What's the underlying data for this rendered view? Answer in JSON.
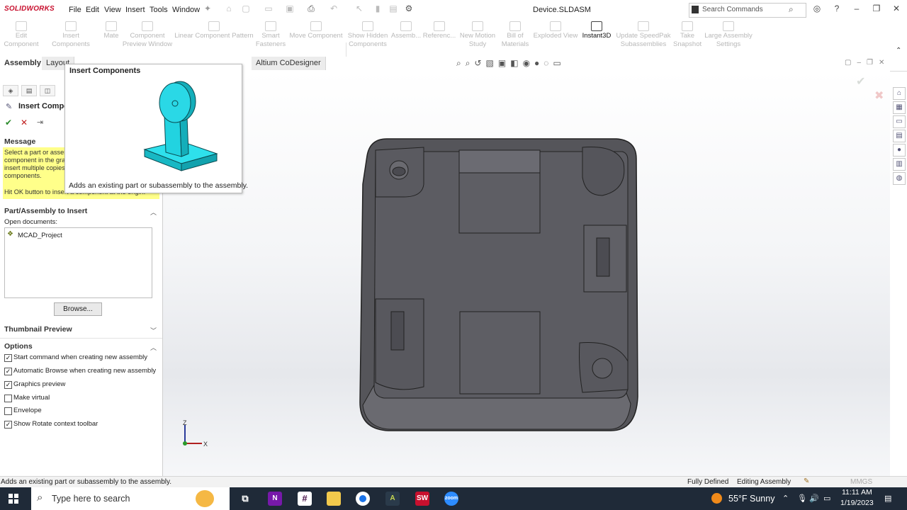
{
  "app": {
    "logo": "SOLIDWORKS",
    "menus": [
      "File",
      "Edit",
      "View",
      "Insert",
      "Tools",
      "Window"
    ],
    "document_title": "Device.SLDASM",
    "search_placeholder": "Search Commands"
  },
  "command_manager": {
    "buttons": [
      {
        "label": "Edit\nComponent"
      },
      {
        "label": "Insert Components"
      },
      {
        "label": "Mate"
      },
      {
        "label": "Component\nPreview Window"
      },
      {
        "label": "Linear Component Pattern"
      },
      {
        "label": "Smart\nFasteners"
      },
      {
        "label": "Move Component"
      },
      {
        "label": "Show Hidden\nComponents"
      },
      {
        "label": "Assemb..."
      },
      {
        "label": "Referenc..."
      },
      {
        "label": "New Motion\nStudy"
      },
      {
        "label": "Bill of\nMaterials"
      },
      {
        "label": "Exploded View"
      },
      {
        "label": "Instant3D"
      },
      {
        "label": "Update SpeedPak\nSubassemblies"
      },
      {
        "label": "Take\nSnapshot"
      },
      {
        "label": "Large Assembly\nSettings"
      }
    ]
  },
  "tabs": [
    "Assembly",
    "Layout",
    "Altium CoDesigner"
  ],
  "property_manager": {
    "title": "Insert Compo",
    "message_header": "Message",
    "message_lines": [
      "Select a part or assem",
      "component in the gra",
      "insert multiple copies",
      "components.",
      "",
      "Hit OK button to insert a component at the origin."
    ],
    "part_assembly_header": "Part/Assembly to Insert",
    "open_documents_label": "Open documents:",
    "open_documents": [
      "MCAD_Project"
    ],
    "browse_label": "Browse...",
    "thumbnail_header": "Thumbnail Preview",
    "options_header": "Options",
    "options": [
      {
        "label": "Start command when creating new assembly",
        "checked": true
      },
      {
        "label": "Automatic Browse when creating new assembly",
        "checked": true
      },
      {
        "label": "Graphics preview",
        "checked": true
      },
      {
        "label": "Make virtual",
        "checked": false
      },
      {
        "label": "Envelope",
        "checked": false
      },
      {
        "label": "Show Rotate context toolbar",
        "checked": true
      }
    ]
  },
  "tooltip": {
    "title": "Insert Components",
    "description": "Adds an existing part or subassembly to the assembly."
  },
  "triad": {
    "z": "Z",
    "x": "X"
  },
  "status_bar": {
    "message": "Adds an existing part or subassembly to the assembly.",
    "state": "Fully Defined",
    "mode": "Editing Assembly",
    "units": "MMGS"
  },
  "taskbar": {
    "search_placeholder": "Type here to search",
    "weather": "55°F  Sunny",
    "time": "11:11 AM",
    "date": "1/19/2023"
  },
  "colors": {
    "accent": "#c8102e",
    "model_face": "#5a5a5e",
    "model_edge": "#2a2a2a",
    "thumbnail_part": "#22d3e0",
    "message_bg": "#ffff8a"
  }
}
